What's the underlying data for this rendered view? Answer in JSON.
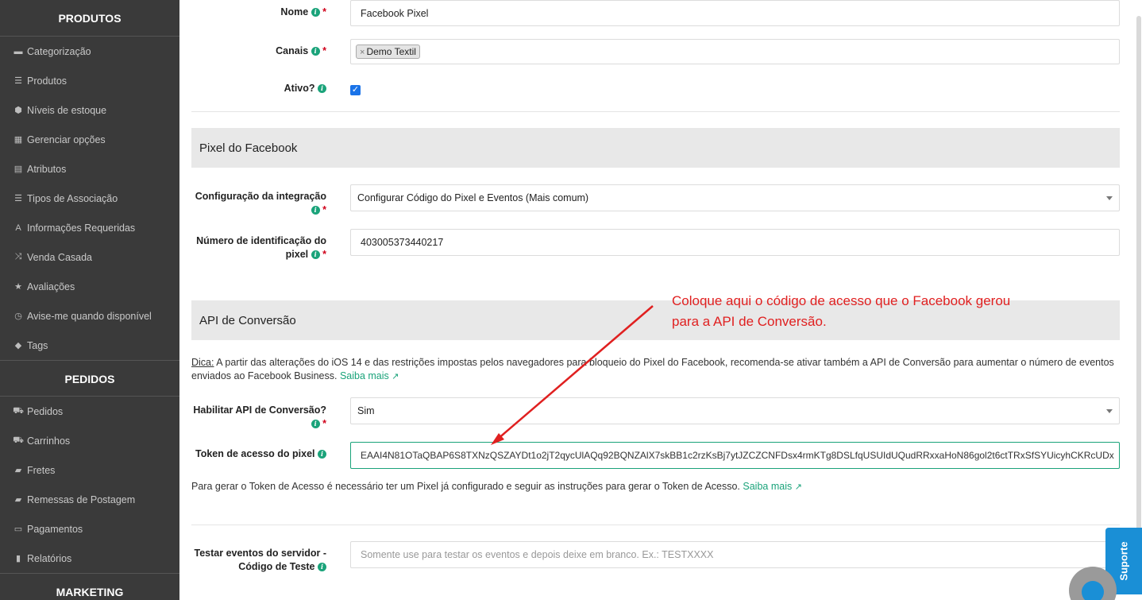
{
  "sidebar": {
    "produtos_heading": "PRODUTOS",
    "produtos_items": [
      {
        "label": "Categorização",
        "icon": "folder-icon"
      },
      {
        "label": "Produtos",
        "icon": "list-icon"
      },
      {
        "label": "Níveis de estoque",
        "icon": "cubes-icon"
      },
      {
        "label": "Gerenciar opções",
        "icon": "grid-icon"
      },
      {
        "label": "Atributos",
        "icon": "list-alt-icon"
      },
      {
        "label": "Tipos de Associação",
        "icon": "list-icon"
      },
      {
        "label": "Informações Requeridas",
        "icon": "font-icon"
      },
      {
        "label": "Venda Casada",
        "icon": "random-icon"
      },
      {
        "label": "Avaliações",
        "icon": "star-icon"
      },
      {
        "label": "Avise-me quando disponível",
        "icon": "clock-icon"
      },
      {
        "label": "Tags",
        "icon": "tag-icon"
      }
    ],
    "pedidos_heading": "PEDIDOS",
    "pedidos_items": [
      {
        "label": "Pedidos",
        "icon": "cart-icon"
      },
      {
        "label": "Carrinhos",
        "icon": "cart-icon"
      },
      {
        "label": "Fretes",
        "icon": "truck-icon"
      },
      {
        "label": "Remessas de Postagem",
        "icon": "truck-icon"
      },
      {
        "label": "Pagamentos",
        "icon": "credit-card-icon"
      },
      {
        "label": "Relatórios",
        "icon": "bar-chart-icon"
      }
    ],
    "marketing_heading": "MARKETING"
  },
  "form": {
    "nome_label": "Nome",
    "nome_value": "Facebook Pixel",
    "canais_label": "Canais",
    "canais_tag": "Demo Textil",
    "ativo_label": "Ativo?",
    "ativo_checked": true,
    "pixel_section_title": "Pixel do Facebook",
    "config_label": "Configuração da integração",
    "config_value": "Configurar Código do Pixel e Eventos (Mais comum)",
    "pixel_id_label_1": "Número de identificação do",
    "pixel_id_label_2": "pixel",
    "pixel_id_value": "403005373440217",
    "api_section_title": "API de Conversão",
    "dica_label": "Dica:",
    "dica_text": " A partir das alterações do iOS 14 e das restrições impostas pelos navegadores para bloqueio do Pixel do Facebook, recomenda-se ativar também a API de Conversão para aumentar o número de eventos",
    "dica_text_2": "enviados ao Facebook Business.",
    "saiba_mais": "Saiba mais",
    "habilitar_label": "Habilitar API de Conversão?",
    "habilitar_value": "Sim",
    "token_label": "Token de acesso do pixel",
    "token_value": "EAAI4N81OTaQBAP6S8TXNzQSZAYDt1o2jT2qycUlAQq92BQNZAlX7skBB1c2rzKsBj7ytJZCZCNFDsx4rmKTg8DSLfqUSUIdUQudRRxxaHoN86gol2t6ctTRxSfSYUicyhCKRcUDx",
    "token_help": "Para gerar o Token de Acesso é necessário ter um Pixel já configurado e seguir as instruções para gerar o Token de Acesso.",
    "testar_label_1": "Testar eventos do servidor -",
    "testar_label_2": "Código de Teste",
    "testar_placeholder": "Somente use para testar os eventos e depois deixe em branco. Ex.: TESTXXXX"
  },
  "annotation": {
    "line1": "Coloque aqui o código de acesso que o Facebook gerou",
    "line2": "para a API de Conversão."
  },
  "support": {
    "label": "Suporte"
  },
  "colors": {
    "sidebar_bg": "#3a3a3a",
    "accent_green": "#1aa37a",
    "required_red": "#d0021b",
    "annotation_red": "#e02020",
    "support_blue": "#1a8fd6"
  }
}
